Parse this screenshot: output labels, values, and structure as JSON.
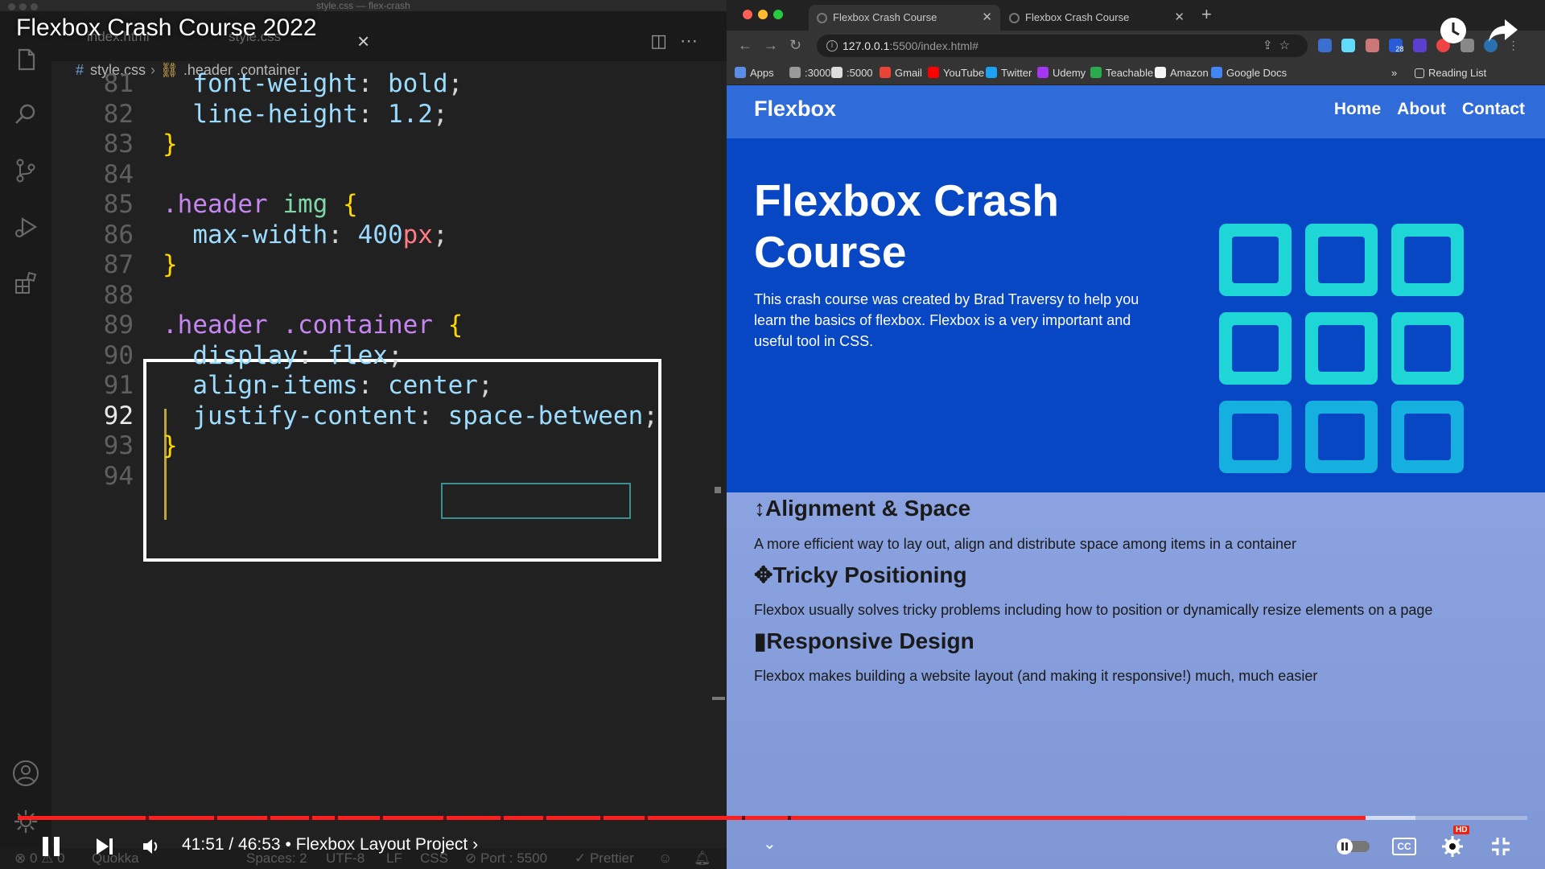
{
  "vscode": {
    "window_title": "style.css — flex-crash",
    "tabs": [
      {
        "label": "index.html"
      },
      {
        "label": "style.css"
      }
    ],
    "breadcrumb": {
      "file": "style.css",
      "symbol": ".header .container"
    },
    "lines": [
      {
        "num": "81",
        "parts": [
          [
            "  ",
            "pun"
          ],
          [
            "font-weight",
            "prop"
          ],
          [
            ": ",
            "pun"
          ],
          [
            "bold",
            "val"
          ],
          [
            ";",
            "pun"
          ]
        ]
      },
      {
        "num": "82",
        "parts": [
          [
            "  ",
            "pun"
          ],
          [
            "line-height",
            "prop"
          ],
          [
            ": ",
            "pun"
          ],
          [
            "1.2",
            "num"
          ],
          [
            ";",
            "pun"
          ]
        ]
      },
      {
        "num": "83",
        "parts": [
          [
            "}",
            "brace"
          ]
        ]
      },
      {
        "num": "84",
        "parts": []
      },
      {
        "num": "85",
        "parts": [
          [
            ".header ",
            "sel"
          ],
          [
            "img",
            "tok-tag"
          ],
          [
            " ",
            "pun"
          ],
          [
            "{",
            "brace"
          ]
        ]
      },
      {
        "num": "86",
        "parts": [
          [
            "  ",
            "pun"
          ],
          [
            "max-width",
            "prop"
          ],
          [
            ": ",
            "pun"
          ],
          [
            "400",
            "num"
          ],
          [
            "px",
            "unit"
          ],
          [
            ";",
            "pun"
          ]
        ]
      },
      {
        "num": "87",
        "parts": [
          [
            "}",
            "brace"
          ]
        ]
      },
      {
        "num": "88",
        "parts": []
      },
      {
        "num": "89",
        "parts": [
          [
            ".header .container ",
            "sel"
          ],
          [
            "{",
            "brace"
          ]
        ]
      },
      {
        "num": "90",
        "parts": [
          [
            "  ",
            "pun"
          ],
          [
            "display",
            "prop"
          ],
          [
            ": ",
            "pun"
          ],
          [
            "flex",
            "val"
          ],
          [
            ";",
            "pun"
          ]
        ]
      },
      {
        "num": "91",
        "parts": [
          [
            "  ",
            "pun"
          ],
          [
            "align-items",
            "prop"
          ],
          [
            ": ",
            "pun"
          ],
          [
            "center",
            "val"
          ],
          [
            ";",
            "pun"
          ]
        ]
      },
      {
        "num": "92",
        "parts": [
          [
            "  ",
            "pun"
          ],
          [
            "justify-content",
            "prop"
          ],
          [
            ": ",
            "pun"
          ],
          [
            "space-between",
            "val"
          ],
          [
            ";",
            "pun"
          ]
        ],
        "active": true
      },
      {
        "num": "93",
        "parts": [
          [
            "}",
            "brace"
          ]
        ]
      },
      {
        "num": "94",
        "parts": []
      }
    ],
    "status": {
      "errors": "⊗ 0 ⚠ 0",
      "quokka": "Quokka",
      "spaces": "Spaces: 2",
      "encoding": "UTF-8",
      "eol": "LF",
      "language": "CSS",
      "port": "⊘ Port : 5500",
      "prettier": "✓ Prettier"
    }
  },
  "browser": {
    "tabs": [
      {
        "label": "Flexbox Crash Course",
        "active": true
      },
      {
        "label": "Flexbox Crash Course",
        "active": false
      }
    ],
    "url_host": "127.0.0.1",
    "url_path": ":5500/index.html#",
    "ext_badge": "28",
    "bookmarks": [
      {
        "label": "Apps",
        "color": "#5a8de8"
      },
      {
        "label": ":3000",
        "color": "#999999"
      },
      {
        "label": ":5000",
        "color": "#dddddd"
      },
      {
        "label": "Gmail",
        "color": "#ea4335"
      },
      {
        "label": "YouTube",
        "color": "#ff0000"
      },
      {
        "label": "Twitter",
        "color": "#1da1f2"
      },
      {
        "label": "Udemy",
        "color": "#a435f0"
      },
      {
        "label": "Teachable",
        "color": "#2ba94d"
      },
      {
        "label": "Amazon",
        "color": "#f5f5f5"
      },
      {
        "label": "Google Docs",
        "color": "#4285f4"
      }
    ],
    "overflow": "»",
    "reading_list": "Reading List"
  },
  "site": {
    "logo": "Flexbox",
    "nav": [
      "Home",
      "About",
      "Contact"
    ],
    "hero_title": "Flexbox Crash Course",
    "hero_text": "This crash course was created by Brad Traversy to help you learn the basics of flexbox. Flexbox is a very important and useful tool in CSS.",
    "features": [
      {
        "icon": "↕",
        "title": "Alignment & Space",
        "text": "A more efficient way to lay out, align and distribute space among items in a container"
      },
      {
        "icon": "✥",
        "title": "Tricky Positioning",
        "text": "Flexbox usually solves tricky problems including how to position or dynamically resize elements on a page"
      },
      {
        "icon": "▮",
        "title": "Responsive Design",
        "text": "Flexbox makes building a website layout (and making it responsive!) much, much easier"
      }
    ],
    "colors": {
      "navbar": "#2f6bd9",
      "hero": "#0747c4",
      "squares_top": "#1fd6d6",
      "squares_bottom": "#16b0e0"
    }
  },
  "video": {
    "title": "Flexbox Crash Course 2022",
    "time": "41:51 / 46:53",
    "chapter": "• Flexbox Layout Project ›",
    "played_fraction": 0.893,
    "buffered_fraction": 0.926,
    "hd_badge": "HD",
    "cc_label": "CC"
  }
}
